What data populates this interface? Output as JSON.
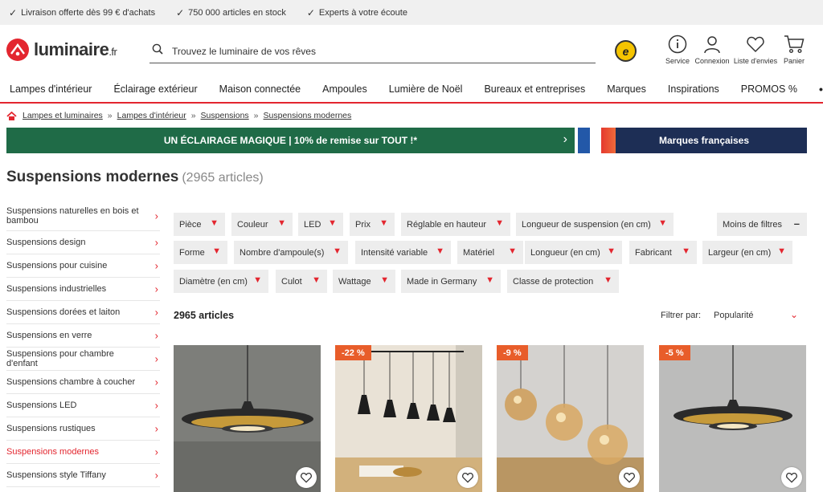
{
  "topbar": {
    "usps": [
      "Livraison offerte dès 99 € d'achats",
      "750 000 articles en stock",
      "Experts à votre écoute"
    ]
  },
  "header": {
    "logo": "luminaire",
    "logo_tld": ".fr",
    "search_placeholder": "Trouvez le luminaire de vos rêves",
    "trust_badge": "e",
    "icons": {
      "service": "Service",
      "account": "Connexion",
      "wishlist": "Liste d'envies",
      "cart": "Panier"
    }
  },
  "nav": {
    "items": [
      "Lampes d'intérieur",
      "Éclairage extérieur",
      "Maison connectée",
      "Ampoules",
      "Lumière de Noël",
      "Bureaux et entreprises",
      "Marques",
      "Inspirations",
      "PROMOS %"
    ],
    "more": "•••"
  },
  "breadcrumb": [
    "Lampes et luminaires",
    "Lampes d'intérieur",
    "Suspensions",
    "Suspensions modernes"
  ],
  "breadcrumb_separator": "»",
  "promo_banner": "UN ÉCLAIRAGE MAGIQUE | 10% de remise sur TOUT !*",
  "brand_banner": "Marques françaises",
  "page": {
    "title": "Suspensions modernes",
    "count": "(2965 articles)"
  },
  "sidebar": {
    "items": [
      {
        "label": "Suspensions naturelles en bois et bambou",
        "active": false
      },
      {
        "label": "Suspensions design",
        "active": false
      },
      {
        "label": "Suspensions pour cuisine",
        "active": false
      },
      {
        "label": "Suspensions industrielles",
        "active": false
      },
      {
        "label": "Suspensions dorées et laiton",
        "active": false
      },
      {
        "label": "Suspensions en verre",
        "active": false
      },
      {
        "label": "Suspensions pour chambre d'enfant",
        "active": false
      },
      {
        "label": "Suspensions chambre à coucher",
        "active": false
      },
      {
        "label": "Suspensions LED",
        "active": false
      },
      {
        "label": "Suspensions rustiques",
        "active": false
      },
      {
        "label": "Suspensions modernes",
        "active": true
      },
      {
        "label": "Suspensions style Tiffany",
        "active": false
      }
    ]
  },
  "filters": {
    "row1": [
      "Pièce",
      "Couleur",
      "LED",
      "Prix",
      "Réglable en hauteur",
      "Longueur de suspension (en cm)"
    ],
    "less": "Moins de filtres",
    "row2": [
      "Forme",
      "Nombre d'ampoule(s)",
      "Intensité variable",
      "Matériel",
      "Longueur (en cm)",
      "Fabricant",
      "Largeur (en cm)"
    ],
    "row3": [
      "Diamètre (en cm)",
      "Culot",
      "Wattage",
      "Made in Germany",
      "Classe de protection"
    ]
  },
  "results": {
    "count": "2965 articles",
    "sort_label": "Filtrer par:",
    "sort_value": "Popularité"
  },
  "products": [
    {
      "badge": ""
    },
    {
      "badge": "-22 %"
    },
    {
      "badge": "-9 %"
    },
    {
      "badge": "-5 %"
    }
  ],
  "colors": {
    "accent": "#e3262f",
    "promo_green": "#1f6b47",
    "brand_navy": "#1d2e55",
    "badge_orange": "#e85d2a"
  }
}
